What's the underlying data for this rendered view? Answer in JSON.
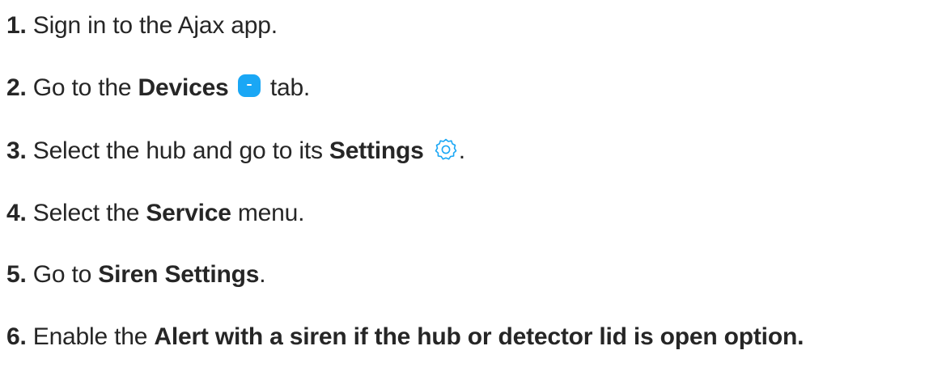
{
  "steps": [
    {
      "number": "1.",
      "parts": [
        "Sign in to the Ajax app."
      ]
    },
    {
      "number": "2.",
      "parts": [
        "Go to the ",
        "Devices",
        " tab."
      ],
      "icon": "devices-icon"
    },
    {
      "number": "3.",
      "parts": [
        "Select the hub and go to its ",
        "Settings",
        "."
      ],
      "icon": "gear-icon"
    },
    {
      "number": "4.",
      "parts": [
        "Select the ",
        "Service",
        " menu."
      ]
    },
    {
      "number": "5.",
      "parts": [
        "Go to ",
        "Siren Settings",
        "."
      ]
    },
    {
      "number": "6.",
      "parts": [
        "Enable the ",
        "Alert with a siren if the hub or detector lid is open option."
      ]
    }
  ],
  "colors": {
    "text": "#262626",
    "accent": "#1aa7f5"
  }
}
